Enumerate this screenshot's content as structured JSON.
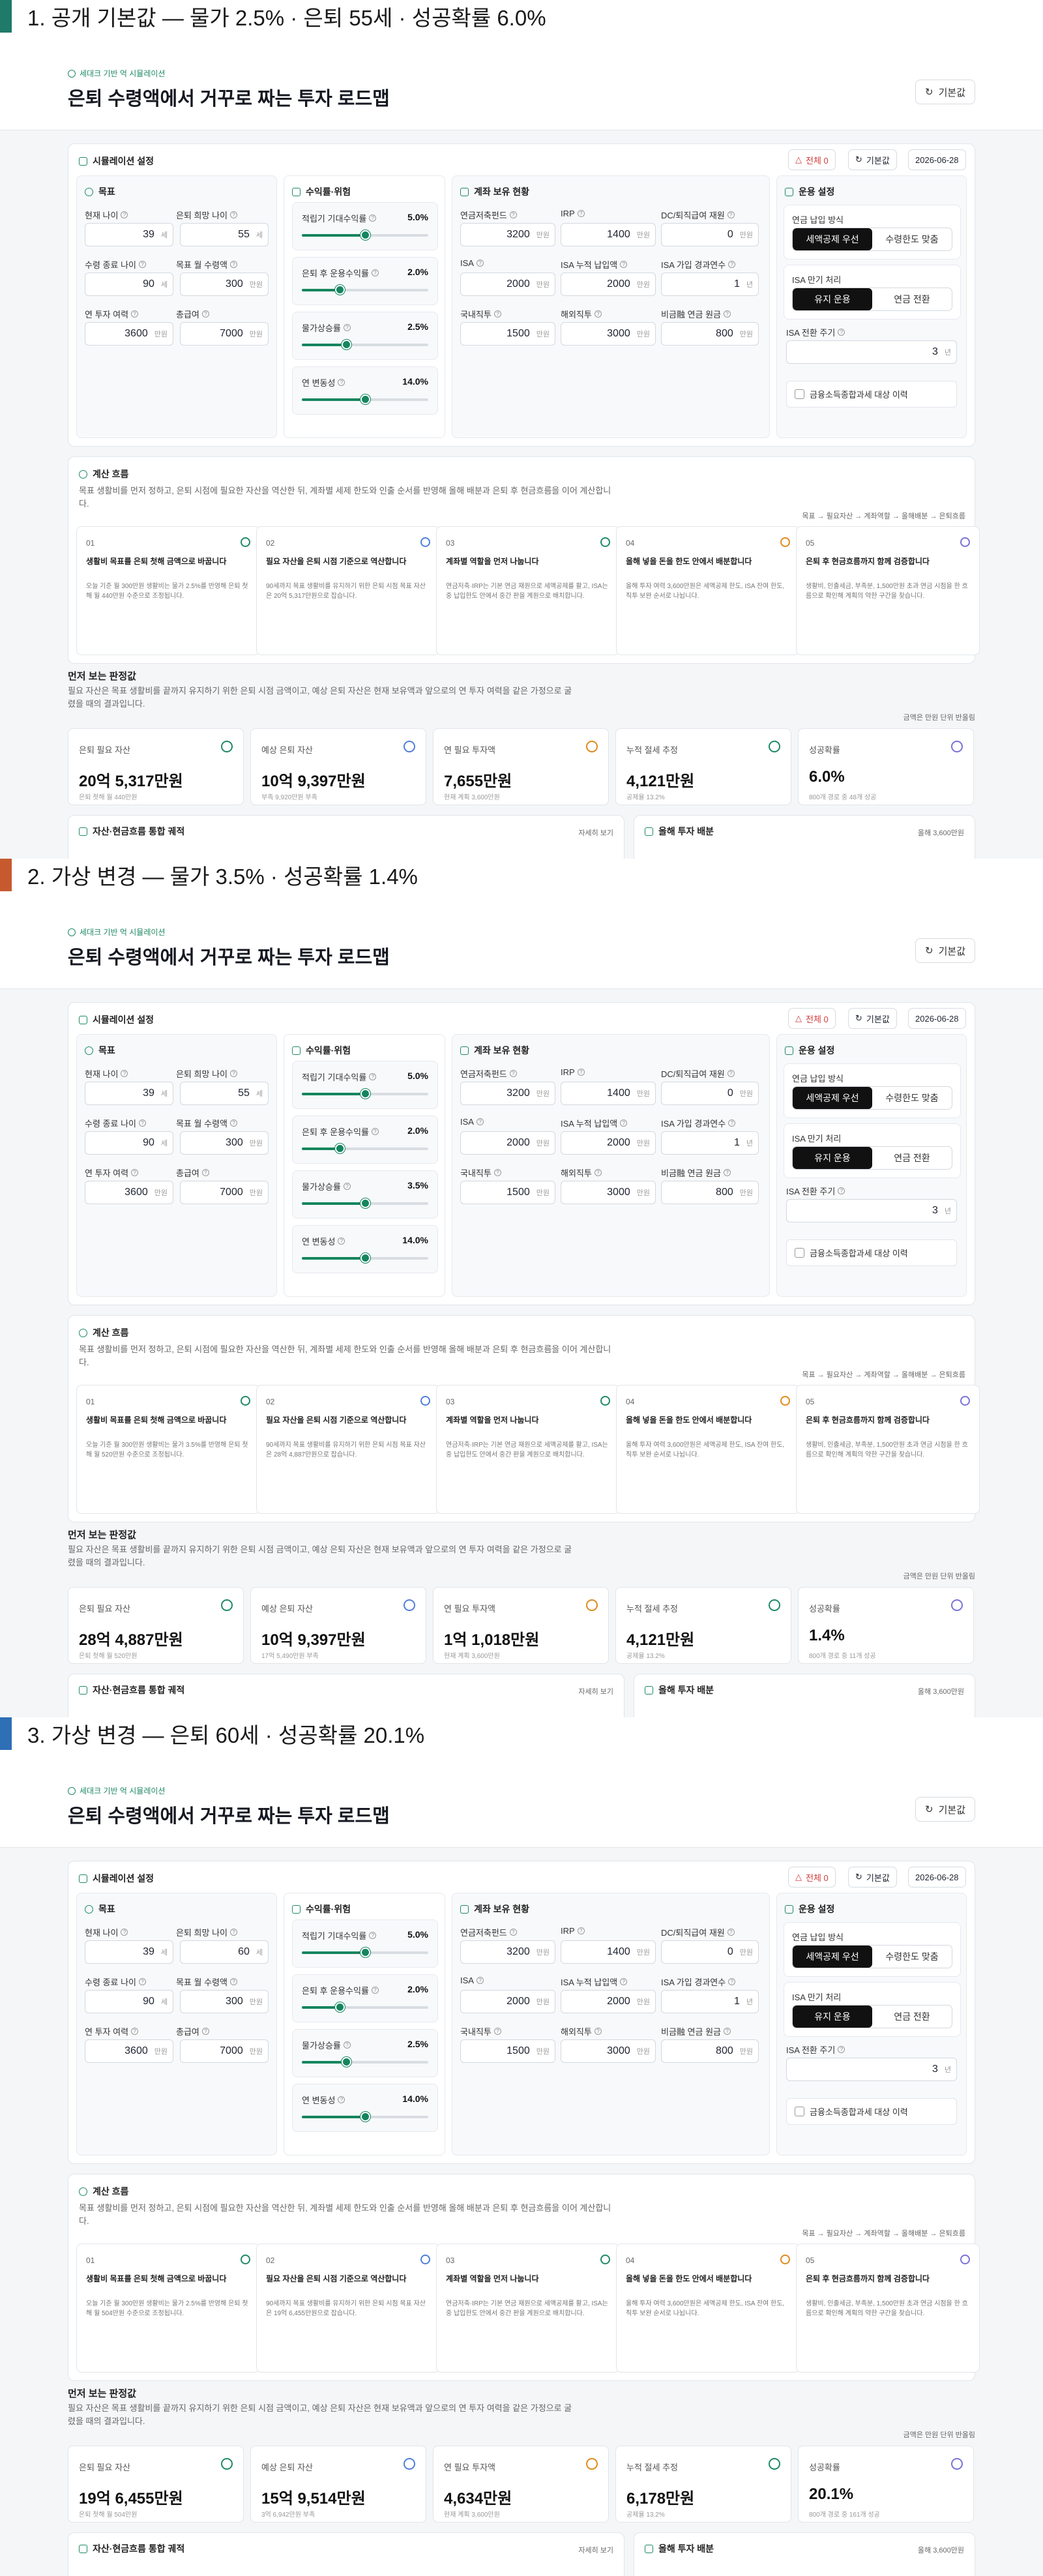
{
  "common": {
    "eyebrow": "세대크 기반 억 시뮬레이션",
    "title": "은퇴 수령액에서 거꾸로 짜는 투자 로드맵",
    "reset_label": "기본값",
    "settings_title": "시뮬레이션 설정",
    "warn_label": "전체 0",
    "reset2_label": "기본값",
    "date": "2026-06-28",
    "goal": {
      "title": "목표",
      "current_age": "현재 나이",
      "retire_age": "은퇴 희망 나이",
      "life_age": "수령 종료 나이",
      "monthly_target": "목표 월 수령액",
      "annual_invest": "연 투자 여력",
      "lump": "총급여",
      "unit_age": "세",
      "unit_won": "만원"
    },
    "returns": {
      "title": "수익률·위험",
      "r1": "적립기 기대수익률",
      "r2": "은퇴 후 운용수익률",
      "r3": "물가상승률",
      "r4": "연 변동성"
    },
    "accounts": {
      "title": "계좌 보유 현황",
      "pension": "연금저축펀드",
      "irp": "IRP",
      "dc": "DC/퇴직급여 재원",
      "isa": "ISA",
      "isa_paid": "ISA 누적 납입액",
      "isa_years": "ISA 가입 경과연수",
      "domestic": "국내직투",
      "overseas": "해외직투",
      "nonpension": "비금融 연금 원금",
      "unit_won": "만원",
      "unit_year": "년"
    },
    "ops": {
      "title": "운용 설정",
      "order_label": "연금 납입 방식",
      "order_opts": [
        "세액공제 우선",
        "수령한도 맞춤"
      ],
      "isa_label": "ISA 만기 처리",
      "isa_opts": [
        "유지 운용",
        "연금 전환"
      ],
      "cycle_label": "ISA 전환 주기",
      "cycle_value": "3",
      "cycle_unit": "년",
      "tax_check": "금융소득종합과세 대상 이력"
    },
    "flow": {
      "title": "계산 흐름",
      "desc": "목표 생활비를 먼저 정하고, 은퇴 시점에 필요한 자산을 역산한 뒤, 계좌별 세제 한도와 인출 순서를 반영해 올해 배분과 은퇴 후 현금흐름을 이어 계산합니다.",
      "trail": "목표 → 필요자산 → 계좌역할 → 올해배분 → 은퇴흐름"
    },
    "steps": [
      {
        "num": "01",
        "title": "생활비 목표를 은퇴 첫해 금액으로 바꿉니다",
        "color": "#1f8a63"
      },
      {
        "num": "02",
        "title": "필요 자산을 은퇴 시점 기준으로 역산합니다",
        "color": "#4f7fd9"
      },
      {
        "num": "03",
        "title": "계좌별 역할을 먼저 나눕니다",
        "color": "#1f8a63",
        "desc": "연금저축·IRP는 기본 연금 재원으로 세액공제를 활고, ISA는 중 납입한도 안에서 중간 판을 계원으로 배치합니다."
      },
      {
        "num": "04",
        "title": "올해 넣을 돈을 한도 안에서 배분합니다",
        "color": "#e08a1c",
        "desc": "올해 투자 여력 3,600만원은 세액공제 한도, ISA 잔여 한도, 직투 보완 순서로 나뉩니다."
      },
      {
        "num": "05",
        "title": "은퇴 후 현금흐름까지 함께 검증합니다",
        "color": "#7a72d8",
        "desc": "생활비, 인출세금, 부족분, 1,500만원 초과 연금 시점을 한 흐름으로 확인해 계획의 약한 구간을 찾습니다."
      }
    ],
    "judge": {
      "title": "먼저 보는 판정값",
      "desc": "필요 자산은 목표 생활비를 끝까지 유지하기 위한 은퇴 시점 금액이고, 예상 은퇴 자산은 현재 보유액과 앞으로의 연 투자 여력을 같은 가정으로 굴렸을 때의 결과입니다.",
      "unit_note": "금액은 만원 단위 반올림",
      "k1": "은퇴 필요 자산",
      "k2": "예상 은퇴 자산",
      "k3": "연 필요 투자액",
      "k4": "누적 절세 추정",
      "k5": "성공확률"
    },
    "bottom": {
      "left": "자산·현금흐름 통합 궤적",
      "right": "올해 투자 배분",
      "right_val": "올해 3,600만원"
    }
  },
  "scenarios": [
    {
      "heading": "1. 공개 기본값 — 물가 2.5% · 은퇴 55세 · 성공확률 6.0%",
      "bar_color": "#1f7a6a",
      "values": {
        "current_age": "39",
        "retire_age": "55",
        "life_age": "90",
        "monthly_target": "300",
        "annual_invest": "3600",
        "lump": "7000"
      },
      "sliders": {
        "r1": "5.0%",
        "r2": "2.0%",
        "r3": "2.5%",
        "r4": "14.0%"
      },
      "slider_levels": {
        "r1": 0.5,
        "r2": 0.3,
        "r3": 0.35,
        "r4": 0.5
      },
      "accounts": {
        "pension": "3200",
        "irp": "1400",
        "dc": "0",
        "isa": "2000",
        "isa_paid": "2000",
        "isa_years": "1",
        "domestic": "1500",
        "overseas": "3000",
        "nonpension": "800"
      },
      "step1_desc": "오늘 기준 월 300만원 생활비는 물가 2.5%를 반영해 은퇴 첫해 월 440만원 수준으로 조정됩니다.",
      "step2_desc": "90세까지 목표 생활비를 유지하기 위한 은퇴 시점 목표 자산은 20억 5,317만원으로 잡습니다.",
      "kpi": [
        {
          "v": "20억 5,317만원",
          "s": "은퇴 첫해 월 440만원"
        },
        {
          "v": "10억 9,397만원",
          "s": "부족 9,920만원 부족"
        },
        {
          "v": "7,655만원",
          "s": "현재 계획 3,600만원"
        },
        {
          "v": "4,121만원",
          "s": "공제율 13.2%"
        },
        {
          "v": "6.0%",
          "s": "800개 경로 중 48개 성공"
        }
      ],
      "bottom_mid": "자세히 보기"
    },
    {
      "heading": "2. 가상 변경 — 물가 3.5% · 성공확률 1.4%",
      "bar_color": "#c65a2e",
      "values": {
        "current_age": "39",
        "retire_age": "55",
        "life_age": "90",
        "monthly_target": "300",
        "annual_invest": "3600",
        "lump": "7000"
      },
      "sliders": {
        "r1": "5.0%",
        "r2": "2.0%",
        "r3": "3.5%",
        "r4": "14.0%"
      },
      "slider_levels": {
        "r1": 0.5,
        "r2": 0.3,
        "r3": 0.5,
        "r4": 0.5
      },
      "accounts": {
        "pension": "3200",
        "irp": "1400",
        "dc": "0",
        "isa": "2000",
        "isa_paid": "2000",
        "isa_years": "1",
        "domestic": "1500",
        "overseas": "3000",
        "nonpension": "800"
      },
      "step1_desc": "오늘 기준 월 300만원 생활비는 물가 3.5%를 반영해 은퇴 첫해 월 520만원 수준으로 조정됩니다.",
      "step2_desc": "90세까지 목표 생활비를 유지하기 위한 은퇴 시점 목표 자산은 28억 4,887만원으로 잡습니다.",
      "kpi": [
        {
          "v": "28억 4,887만원",
          "s": "은퇴 첫해 월 520만원"
        },
        {
          "v": "10억 9,397만원",
          "s": "17억 5,490만원 부족"
        },
        {
          "v": "1억 1,018만원",
          "s": "현재 계획 3,600만원"
        },
        {
          "v": "4,121만원",
          "s": "공제율 13.2%"
        },
        {
          "v": "1.4%",
          "s": "800개 경로 중 11개 성공"
        }
      ],
      "bottom_mid": "자세히 보기"
    },
    {
      "heading": "3. 가상 변경 — 은퇴 60세 · 성공확률 20.1%",
      "bar_color": "#2f6fb6",
      "values": {
        "current_age": "39",
        "retire_age": "60",
        "life_age": "90",
        "monthly_target": "300",
        "annual_invest": "3600",
        "lump": "7000"
      },
      "sliders": {
        "r1": "5.0%",
        "r2": "2.0%",
        "r3": "2.5%",
        "r4": "14.0%"
      },
      "slider_levels": {
        "r1": 0.5,
        "r2": 0.3,
        "r3": 0.35,
        "r4": 0.5
      },
      "accounts": {
        "pension": "3200",
        "irp": "1400",
        "dc": "0",
        "isa": "2000",
        "isa_paid": "2000",
        "isa_years": "1",
        "domestic": "1500",
        "overseas": "3000",
        "nonpension": "800"
      },
      "step1_desc": "오늘 기준 월 300만원 생활비는 물가 2.5%를 반영해 은퇴 첫해 월 504만원 수준으로 조정됩니다.",
      "step2_desc": "90세까지 목표 생활비를 유지하기 위한 은퇴 시점 목표 자산은 19억 6,455만원으로 잡습니다.",
      "kpi": [
        {
          "v": "19억 6,455만원",
          "s": "은퇴 첫해 월 504만원"
        },
        {
          "v": "15억 9,514만원",
          "s": "3억 6,942만원 부족"
        },
        {
          "v": "4,634만원",
          "s": "현재 계획 3,600만원"
        },
        {
          "v": "6,178만원",
          "s": "공제율 13.2%"
        },
        {
          "v": "20.1%",
          "s": "800개 경로 중 161개 성공"
        }
      ],
      "bottom_mid": "자세히 보기"
    }
  ]
}
